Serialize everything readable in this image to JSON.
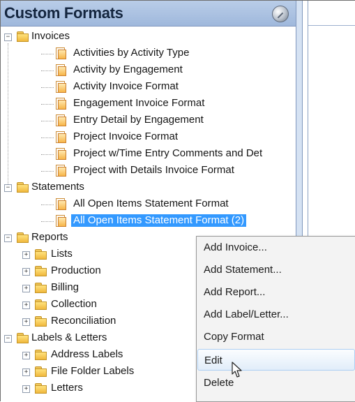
{
  "panel": {
    "title": "Custom Formats",
    "pin_icon": "pushpin-icon"
  },
  "tree": {
    "invoices": {
      "label": "Invoices",
      "items": [
        "Activities by Activity Type",
        "Activity by Engagement",
        "Activity Invoice Format",
        "Engagement Invoice Format",
        "Entry Detail by Engagement",
        "Project Invoice Format",
        "Project w/Time Entry Comments and Det",
        "Project with Details Invoice Format"
      ]
    },
    "statements": {
      "label": "Statements",
      "items": [
        "All Open Items Statement Format",
        "All Open Items Statement Format (2)"
      ]
    },
    "reports": {
      "label": "Reports",
      "items": [
        "Lists",
        "Production",
        "Billing",
        "Collection",
        "Reconciliation"
      ]
    },
    "labels_letters": {
      "label": "Labels & Letters",
      "items": [
        "Address Labels",
        "File Folder Labels",
        "Letters"
      ]
    }
  },
  "context_menu": {
    "items": [
      "Add Invoice...",
      "Add Statement...",
      "Add Report...",
      "Add Label/Letter...",
      "Copy Format",
      "Edit",
      "Delete"
    ],
    "highlighted": "Edit"
  },
  "colors": {
    "header_background": "#b9cde8",
    "selection": "#3399ff",
    "menu_background": "#f3f3f3",
    "menu_highlight_border": "#aecff3"
  }
}
